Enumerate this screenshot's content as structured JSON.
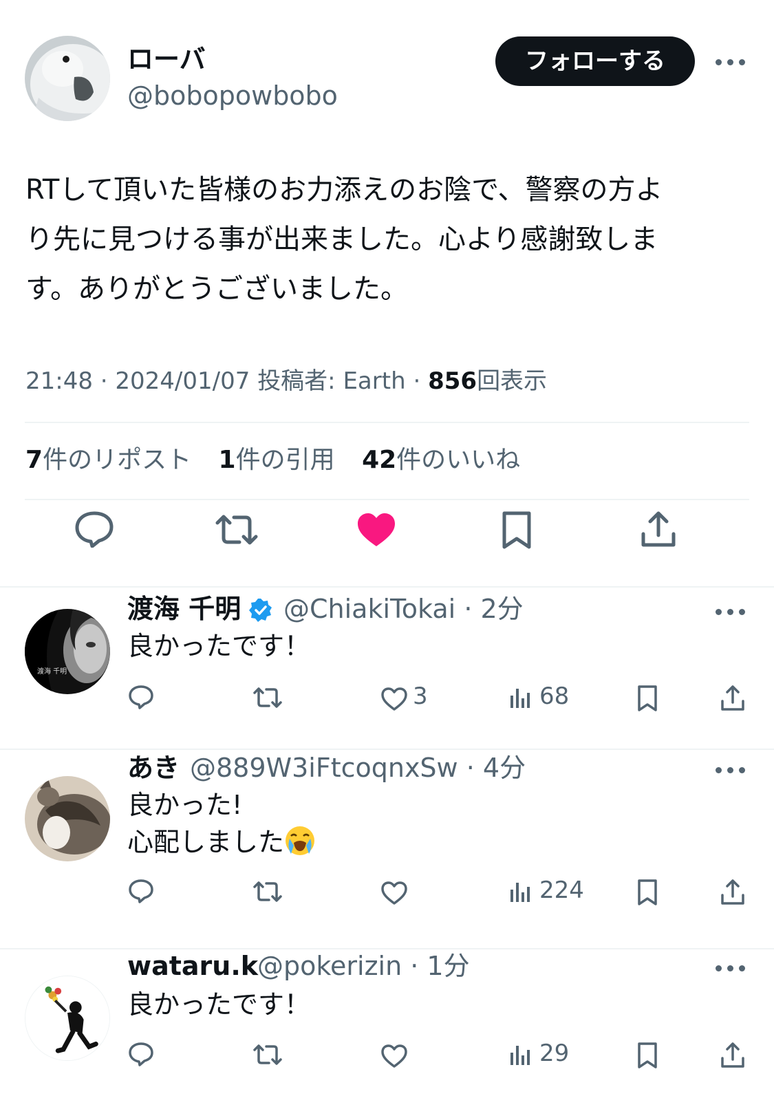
{
  "tweet": {
    "author_name": "ローバ",
    "author_handle": "@bobopowbobo",
    "follow_label": "フォローする",
    "text_line1": "RTして頂いた皆様のお力添えのお陰で、警察の方よ",
    "text_line2": "り先に見つける事が出来ました。心より感謝致しま",
    "text_line3": "す。ありがとうございました。",
    "time": "21:48 · 2024/01/07",
    "posted_by": "投稿者: Earth",
    "meta_sep": "·",
    "views_count": "856",
    "views_label": "回表示",
    "reposts_count": "7",
    "reposts_label": "件のリポスト",
    "quotes_count": "1",
    "quotes_label": "件の引用",
    "likes_count": "42",
    "likes_label": "件のいいね",
    "liked": true,
    "like_color": "#f91880"
  },
  "replies": [
    {
      "name": "渡海 千明",
      "verified": true,
      "handle": "@ChiakiTokai",
      "time": "· 2分",
      "text": "良かったです！",
      "likes": "3",
      "views": "68"
    },
    {
      "name": "あき",
      "handle": "@889W3iFtcoqnxSw",
      "time": "· 4分",
      "text_line1": "良かった!",
      "text_line2": "心配しました",
      "emoji": "loudly-crying-face",
      "views": "224"
    },
    {
      "name": "wataru.k",
      "handle": "@pokerizin",
      "time": "· 1分",
      "text": "良かったです！",
      "views": "29"
    }
  ],
  "avatar_watermark": "渡海 千明",
  "colors": {
    "text": "#0f1419",
    "secondary": "#536471",
    "divider": "#eff3f4",
    "verified": "#1d9bf0",
    "like": "#f91880"
  }
}
